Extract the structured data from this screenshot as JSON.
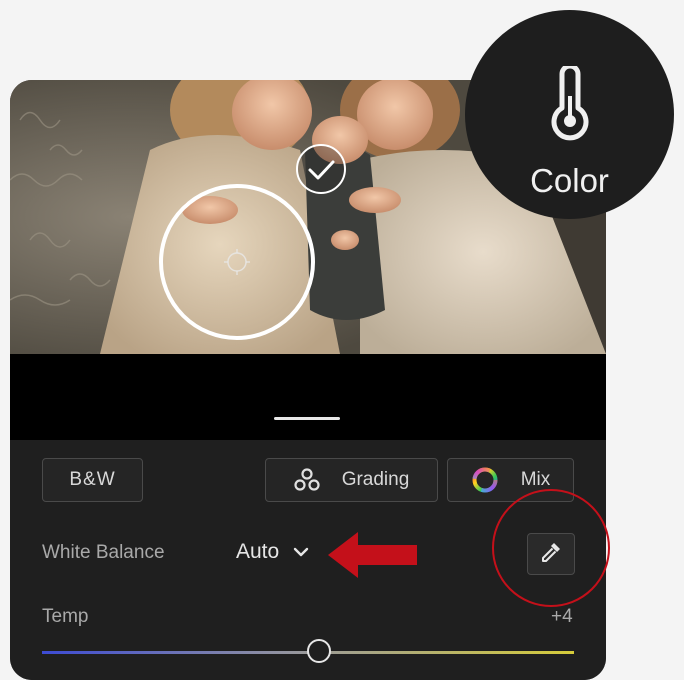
{
  "badge": {
    "label": "Color",
    "icon": "thermometer-icon"
  },
  "toolbar": {
    "bw_label": "B&W",
    "grading_label": "Grading",
    "grading_icon": "grading-circles-icon",
    "mix_label": "Mix",
    "mix_icon": "color-wheel-icon"
  },
  "white_balance": {
    "label": "White Balance",
    "value": "Auto",
    "eyedropper_icon": "eyedropper-icon"
  },
  "temp": {
    "label": "Temp",
    "value": "+4",
    "level": 0.52
  },
  "annotations": {
    "arrow_color": "#c4101a",
    "circle_color": "#c4101a"
  }
}
